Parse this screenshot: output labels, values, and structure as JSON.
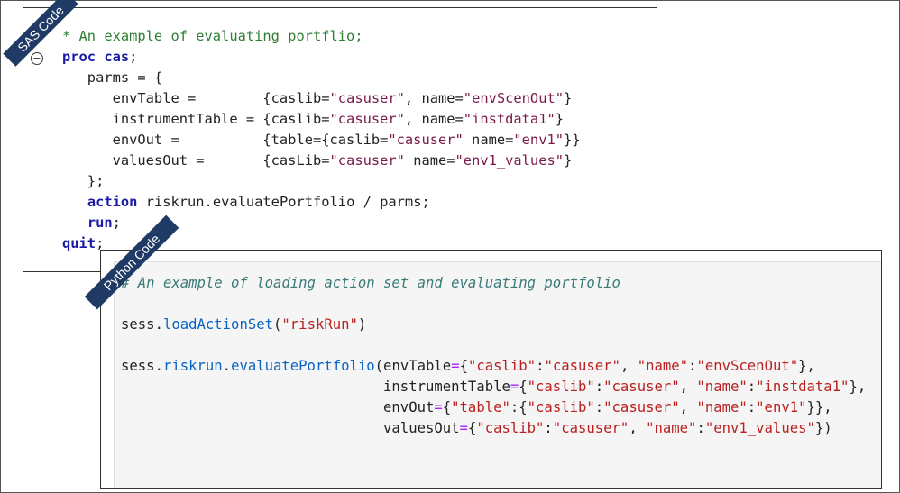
{
  "labels": {
    "sas": "SAS Code",
    "python": "Python Code"
  },
  "sas": {
    "lines": [
      "* An example of evaluating portflio;",
      "proc cas;",
      "   parms = {",
      "      envTable =        {caslib=\"casuser\", name=\"envScenOut\"}",
      "      instrumentTable = {caslib=\"casuser\", name=\"instdata1\"}",
      "      envOut =          {table={caslib=\"casuser\" name=\"env1\"}}",
      "      valuesOut =       {casLib=\"casuser\" name=\"env1_values\"}",
      "   };",
      "   action riskrun.evaluatePortfolio / parms;",
      "   run;",
      "quit;"
    ],
    "fold_icon": "minus-circle-icon"
  },
  "python": {
    "lines": [
      "# An example of loading action set and evaluating portfolio",
      "",
      "sess.loadActionSet(\"riskRun\")",
      "",
      "sess.riskrun.evaluatePortfolio(envTable={\"caslib\":\"casuser\", \"name\":\"envScenOut\"},",
      "                               instrumentTable={\"caslib\":\"casuser\", \"name\":\"instdata1\"},",
      "                               envOut={\"table\":{\"caslib\":\"casuser\", \"name\":\"env1\"}},",
      "                               valuesOut={\"caslib\":\"casuser\", \"name\":\"env1_values\"})"
    ]
  },
  "colors": {
    "ribbon": "#1f3a64",
    "sas_comment": "#2e7d32",
    "sas_keyword": "#1a1aa6",
    "sas_string": "#7a1a4a",
    "py_comment": "#3a7a78",
    "py_name": "#0b63c4",
    "py_string": "#ba2121",
    "py_operator": "#aa22ff"
  }
}
